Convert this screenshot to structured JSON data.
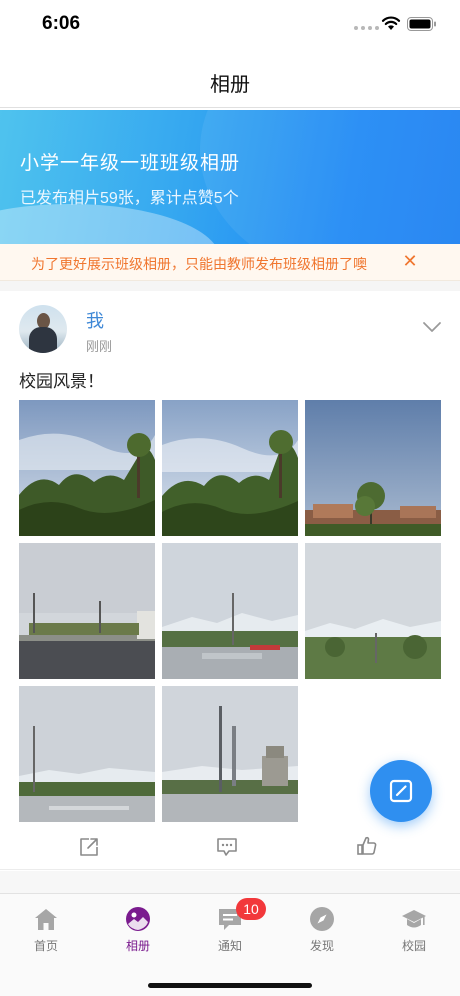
{
  "status_bar": {
    "time": "6:06"
  },
  "nav": {
    "title": "相册"
  },
  "banner": {
    "title": "小学一年级一班班级相册",
    "subtitle": "已发布相片59张，累计点赞5个"
  },
  "notice": {
    "text": "为了更好展示班级相册，只能由教师发布班级相册了噢",
    "close_icon": "close-icon",
    "color": "#f0762f"
  },
  "post": {
    "author": "我",
    "time": "刚刚",
    "text": "校园风景！",
    "photo_count": 8,
    "actions": [
      "share-icon",
      "comment-icon",
      "like-icon"
    ]
  },
  "tabs": [
    {
      "label": "首页",
      "icon": "home-icon",
      "active": false
    },
    {
      "label": "相册",
      "icon": "album-icon",
      "active": true
    },
    {
      "label": "通知",
      "icon": "notice-icon",
      "active": false,
      "badge": "10"
    },
    {
      "label": "发现",
      "icon": "compass-icon",
      "active": false
    },
    {
      "label": "校园",
      "icon": "campus-icon",
      "active": false
    }
  ],
  "colors": {
    "accent": "#3f88d6",
    "active_tab": "#7a1b8e",
    "badge": "#f2383b",
    "fab": "#2f8ff0"
  }
}
